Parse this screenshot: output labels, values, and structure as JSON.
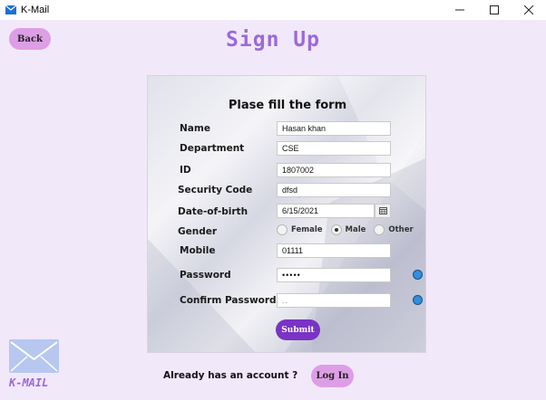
{
  "window": {
    "title": "K-Mail",
    "controls": {
      "minimize": "—",
      "maximize": "☐",
      "close": "✕"
    }
  },
  "back_button": "Back",
  "page_title": "Sign Up",
  "form": {
    "heading": "Plase fill the form",
    "fields": {
      "name": {
        "label": "Name",
        "value": "Hasan khan"
      },
      "department": {
        "label": "Department",
        "value": "CSE"
      },
      "id": {
        "label": "ID",
        "value": "1807002"
      },
      "security_code": {
        "label": "Security Code",
        "value": "dfsd"
      },
      "dob": {
        "label": "Date-of-birth",
        "value": "6/15/2021"
      },
      "gender": {
        "label": "Gender",
        "options": [
          "Female",
          "Male",
          "Other"
        ],
        "selected": "Male"
      },
      "mobile": {
        "label": "Mobile",
        "value": "01111"
      },
      "password": {
        "label": "Password",
        "value": "•••••"
      },
      "confirm_password": {
        "label": "Confirm Password",
        "value": "..",
        "placeholder": ""
      }
    },
    "submit_label": "Submit"
  },
  "login_prompt": "Already has an account ?",
  "login_button": "Log In",
  "logo": {
    "text": "K-MAIL",
    "icon": "envelope-icon"
  },
  "colors": {
    "accent": "#9b6ad9",
    "pill": "#dd9ee6",
    "submit": "#7a33c4",
    "indicator": "#2f8fe0",
    "background": "#f1e8fa"
  }
}
